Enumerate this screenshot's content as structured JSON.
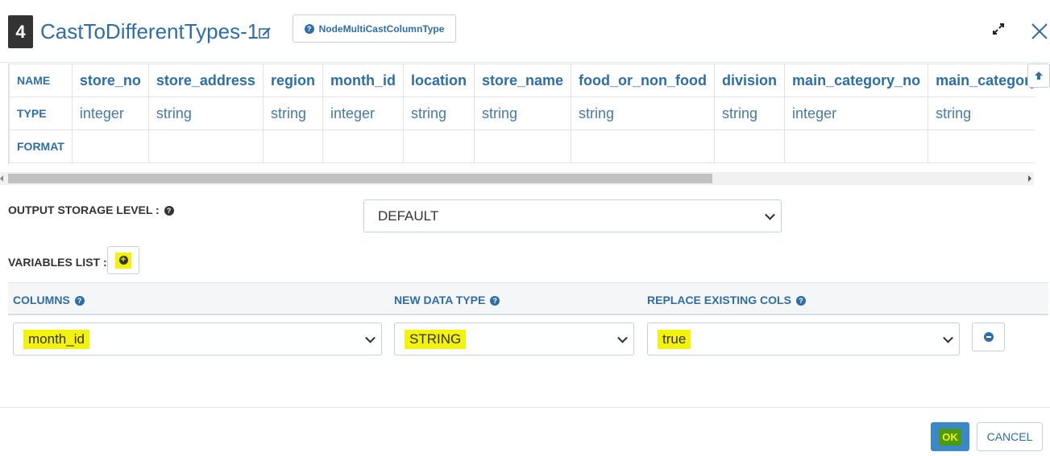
{
  "header": {
    "step_number": "4",
    "title": "CastToDifferentTypes-1",
    "node_type": "NodeMultiCastColumnType"
  },
  "schema": {
    "row_labels": {
      "name": "NAME",
      "type": "TYPE",
      "format": "FORMAT"
    },
    "columns": [
      {
        "name": "store_no",
        "type": "integer",
        "format": ""
      },
      {
        "name": "store_address",
        "type": "string",
        "format": ""
      },
      {
        "name": "region",
        "type": "string",
        "format": ""
      },
      {
        "name": "month_id",
        "type": "integer",
        "format": ""
      },
      {
        "name": "location",
        "type": "string",
        "format": ""
      },
      {
        "name": "store_name",
        "type": "string",
        "format": ""
      },
      {
        "name": "food_or_non_food",
        "type": "string",
        "format": ""
      },
      {
        "name": "division",
        "type": "string",
        "format": ""
      },
      {
        "name": "main_category_no",
        "type": "integer",
        "format": ""
      },
      {
        "name": "main_category_name",
        "type": "string",
        "format": ""
      }
    ],
    "scroll_position": 0.0
  },
  "output_storage": {
    "label": "OUTPUT STORAGE LEVEL :",
    "value": "DEFAULT"
  },
  "variables": {
    "label": "VARIABLES LIST :",
    "headers": {
      "columns": "COLUMNS",
      "new_data_type": "NEW DATA TYPE",
      "replace_existing": "REPLACE EXISTING COLS"
    },
    "rows": [
      {
        "column": "month_id",
        "new_data_type": "STRING",
        "replace_existing": "true"
      }
    ]
  },
  "footer": {
    "ok_label": "OK",
    "cancel_label": "CANCEL"
  },
  "colors": {
    "accent": "#2f6da3",
    "highlight": "#f2f20c",
    "ok_button": "#3a87c9"
  }
}
